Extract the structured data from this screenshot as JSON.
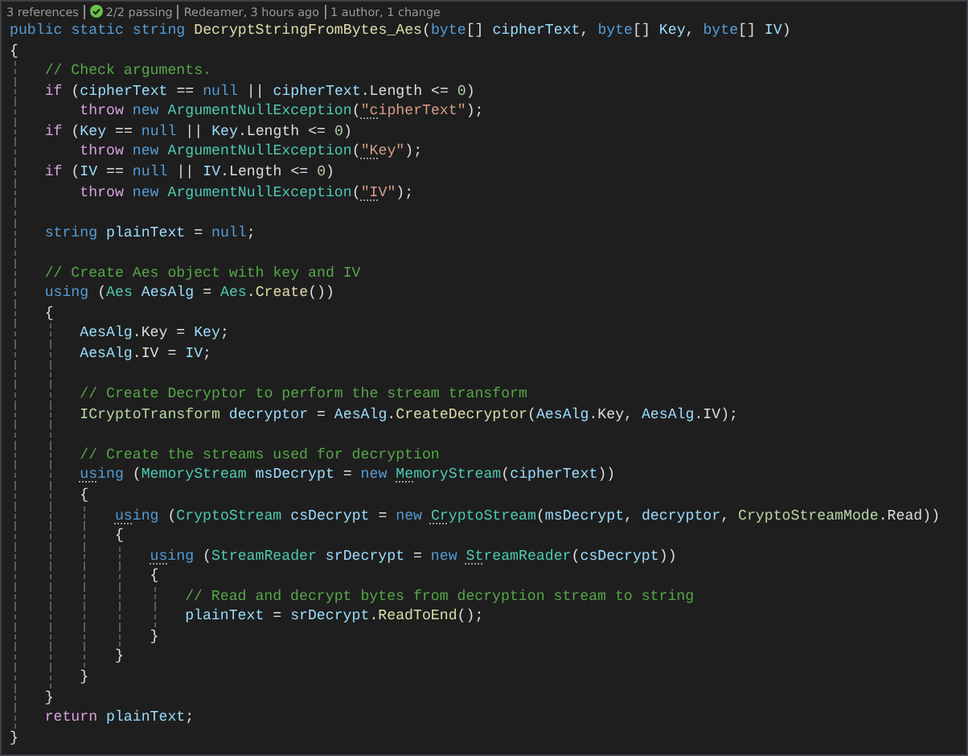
{
  "codelens": [
    {
      "kind": "text",
      "text": "3 references"
    },
    {
      "kind": "tests",
      "text": "2/2 passing",
      "passing": true
    },
    {
      "kind": "text",
      "text": "Redeamer, 3 hours ago"
    },
    {
      "kind": "text",
      "text": "1 author, 1 change"
    }
  ],
  "lines": [
    {
      "kind": "code",
      "tokens": [
        {
          "kind": "keyword",
          "text": "public static string "
        },
        {
          "kind": "method",
          "text": "DecryptStringFromBytes_Aes"
        },
        {
          "kind": "plain",
          "text": "("
        },
        {
          "kind": "keyword",
          "text": "byte"
        },
        {
          "kind": "plain",
          "text": "[] "
        },
        {
          "kind": "variable",
          "text": "cipherText"
        },
        {
          "kind": "plain",
          "text": ", "
        },
        {
          "kind": "keyword",
          "text": "byte"
        },
        {
          "kind": "plain",
          "text": "[] "
        },
        {
          "kind": "variable",
          "text": "Key"
        },
        {
          "kind": "plain",
          "text": ", "
        },
        {
          "kind": "keyword",
          "text": "byte"
        },
        {
          "kind": "plain",
          "text": "[] "
        },
        {
          "kind": "variable",
          "text": "IV"
        },
        {
          "kind": "plain",
          "text": ")"
        }
      ]
    },
    {
      "kind": "code",
      "tokens": [
        {
          "kind": "plain",
          "text": "{"
        }
      ]
    },
    {
      "kind": "code",
      "tokens": [
        {
          "kind": "comment",
          "text": "    // Check arguments."
        }
      ]
    },
    {
      "kind": "code",
      "tokens": [
        {
          "kind": "control",
          "text": "    if"
        },
        {
          "kind": "plain",
          "text": " ("
        },
        {
          "kind": "variable",
          "text": "cipherText"
        },
        {
          "kind": "plain",
          "text": " == "
        },
        {
          "kind": "keyword",
          "text": "null"
        },
        {
          "kind": "plain",
          "text": " || "
        },
        {
          "kind": "variable",
          "text": "cipherText"
        },
        {
          "kind": "plain",
          "text": ".Length <= "
        },
        {
          "kind": "number",
          "text": "0"
        },
        {
          "kind": "plain",
          "text": ")"
        }
      ]
    },
    {
      "kind": "code",
      "tokens": [
        {
          "kind": "control",
          "text": "        throw"
        },
        {
          "kind": "keyword",
          "text": " new"
        },
        {
          "kind": "type",
          "text": " ArgumentNullException"
        },
        {
          "kind": "plain",
          "text": "("
        },
        {
          "kind": "string",
          "text": "\"c",
          "hint": true
        },
        {
          "kind": "string",
          "text": "ipherText\""
        },
        {
          "kind": "plain",
          "text": ");"
        }
      ]
    },
    {
      "kind": "code",
      "tokens": [
        {
          "kind": "control",
          "text": "    if"
        },
        {
          "kind": "plain",
          "text": " ("
        },
        {
          "kind": "variable",
          "text": "Key"
        },
        {
          "kind": "plain",
          "text": " == "
        },
        {
          "kind": "keyword",
          "text": "null"
        },
        {
          "kind": "plain",
          "text": " || "
        },
        {
          "kind": "variable",
          "text": "Key"
        },
        {
          "kind": "plain",
          "text": ".Length <= "
        },
        {
          "kind": "number",
          "text": "0"
        },
        {
          "kind": "plain",
          "text": ")"
        }
      ]
    },
    {
      "kind": "code",
      "tokens": [
        {
          "kind": "control",
          "text": "        throw"
        },
        {
          "kind": "keyword",
          "text": " new"
        },
        {
          "kind": "type",
          "text": " ArgumentNullException"
        },
        {
          "kind": "plain",
          "text": "("
        },
        {
          "kind": "string",
          "text": "\"K",
          "hint": true
        },
        {
          "kind": "string",
          "text": "ey\""
        },
        {
          "kind": "plain",
          "text": ");"
        }
      ]
    },
    {
      "kind": "code",
      "tokens": [
        {
          "kind": "control",
          "text": "    if"
        },
        {
          "kind": "plain",
          "text": " ("
        },
        {
          "kind": "variable",
          "text": "IV"
        },
        {
          "kind": "plain",
          "text": " == "
        },
        {
          "kind": "keyword",
          "text": "null"
        },
        {
          "kind": "plain",
          "text": " || "
        },
        {
          "kind": "variable",
          "text": "IV"
        },
        {
          "kind": "plain",
          "text": ".Length <= "
        },
        {
          "kind": "number",
          "text": "0"
        },
        {
          "kind": "plain",
          "text": ")"
        }
      ]
    },
    {
      "kind": "code",
      "tokens": [
        {
          "kind": "control",
          "text": "        throw"
        },
        {
          "kind": "keyword",
          "text": " new"
        },
        {
          "kind": "type",
          "text": " ArgumentNullException"
        },
        {
          "kind": "plain",
          "text": "("
        },
        {
          "kind": "string",
          "text": "\"I",
          "hint": true
        },
        {
          "kind": "string",
          "text": "V\""
        },
        {
          "kind": "plain",
          "text": ");"
        }
      ]
    },
    {
      "kind": "blank"
    },
    {
      "kind": "code",
      "tokens": [
        {
          "kind": "keyword",
          "text": "    string"
        },
        {
          "kind": "variable",
          "text": " plainText"
        },
        {
          "kind": "plain",
          "text": " = "
        },
        {
          "kind": "keyword",
          "text": "null"
        },
        {
          "kind": "plain",
          "text": ";"
        }
      ]
    },
    {
      "kind": "blank"
    },
    {
      "kind": "code",
      "tokens": [
        {
          "kind": "comment",
          "text": "    // Create Aes object with key and IV"
        }
      ]
    },
    {
      "kind": "code",
      "tokens": [
        {
          "kind": "keyword",
          "text": "    using"
        },
        {
          "kind": "plain",
          "text": " ("
        },
        {
          "kind": "type",
          "text": "Aes"
        },
        {
          "kind": "variable",
          "text": " AesAlg"
        },
        {
          "kind": "plain",
          "text": " = "
        },
        {
          "kind": "type",
          "text": "Aes"
        },
        {
          "kind": "plain",
          "text": "."
        },
        {
          "kind": "method",
          "text": "Create"
        },
        {
          "kind": "plain",
          "text": "())"
        }
      ]
    },
    {
      "kind": "code",
      "tokens": [
        {
          "kind": "plain",
          "text": "    {"
        }
      ]
    },
    {
      "kind": "code",
      "tokens": [
        {
          "kind": "variable",
          "text": "        AesAlg"
        },
        {
          "kind": "plain",
          "text": ".Key = "
        },
        {
          "kind": "variable",
          "text": "Key"
        },
        {
          "kind": "plain",
          "text": ";"
        }
      ]
    },
    {
      "kind": "code",
      "tokens": [
        {
          "kind": "variable",
          "text": "        AesAlg"
        },
        {
          "kind": "plain",
          "text": ".IV = "
        },
        {
          "kind": "variable",
          "text": "IV"
        },
        {
          "kind": "plain",
          "text": ";"
        }
      ]
    },
    {
      "kind": "blank"
    },
    {
      "kind": "code",
      "tokens": [
        {
          "kind": "comment",
          "text": "        // Create Decryptor to perform the stream transform"
        }
      ]
    },
    {
      "kind": "code",
      "tokens": [
        {
          "kind": "interface",
          "text": "        ICryptoTransform"
        },
        {
          "kind": "variable",
          "text": " decryptor"
        },
        {
          "kind": "plain",
          "text": " = "
        },
        {
          "kind": "variable",
          "text": "AesAlg"
        },
        {
          "kind": "plain",
          "text": "."
        },
        {
          "kind": "method",
          "text": "CreateDecryptor"
        },
        {
          "kind": "plain",
          "text": "("
        },
        {
          "kind": "variable",
          "text": "AesAlg"
        },
        {
          "kind": "plain",
          "text": ".Key, "
        },
        {
          "kind": "variable",
          "text": "AesAlg"
        },
        {
          "kind": "plain",
          "text": ".IV);"
        }
      ]
    },
    {
      "kind": "blank"
    },
    {
      "kind": "code",
      "tokens": [
        {
          "kind": "comment",
          "text": "        // Create the streams used for decryption"
        }
      ]
    },
    {
      "kind": "code",
      "tokens": [
        {
          "kind": "keyword",
          "text": "        us",
          "hint": true
        },
        {
          "kind": "keyword",
          "text": "ing"
        },
        {
          "kind": "plain",
          "text": " ("
        },
        {
          "kind": "type",
          "text": "MemoryStream"
        },
        {
          "kind": "variable",
          "text": " msDecrypt"
        },
        {
          "kind": "plain",
          "text": " = "
        },
        {
          "kind": "keyword",
          "text": "new "
        },
        {
          "kind": "type",
          "text": "Me",
          "hint": true
        },
        {
          "kind": "type",
          "text": "moryStream"
        },
        {
          "kind": "plain",
          "text": "("
        },
        {
          "kind": "variable",
          "text": "cipherText"
        },
        {
          "kind": "plain",
          "text": "))"
        }
      ]
    },
    {
      "kind": "code",
      "tokens": [
        {
          "kind": "plain",
          "text": "        {"
        }
      ]
    },
    {
      "kind": "code",
      "tokens": [
        {
          "kind": "keyword",
          "text": "            us",
          "hint": true
        },
        {
          "kind": "keyword",
          "text": "ing"
        },
        {
          "kind": "plain",
          "text": " ("
        },
        {
          "kind": "type",
          "text": "CryptoStream"
        },
        {
          "kind": "variable",
          "text": " csDecrypt"
        },
        {
          "kind": "plain",
          "text": " = "
        },
        {
          "kind": "keyword",
          "text": "new "
        },
        {
          "kind": "type",
          "text": "Cr",
          "hint": true
        },
        {
          "kind": "type",
          "text": "yptoStream"
        },
        {
          "kind": "plain",
          "text": "("
        },
        {
          "kind": "variable",
          "text": "msDecrypt"
        },
        {
          "kind": "plain",
          "text": ", "
        },
        {
          "kind": "variable",
          "text": "decryptor"
        },
        {
          "kind": "plain",
          "text": ", "
        },
        {
          "kind": "enum",
          "text": "CryptoStreamMode"
        },
        {
          "kind": "plain",
          "text": ".Read))"
        }
      ]
    },
    {
      "kind": "code",
      "tokens": [
        {
          "kind": "plain",
          "text": "            {"
        }
      ]
    },
    {
      "kind": "code",
      "tokens": [
        {
          "kind": "keyword",
          "text": "                us",
          "hint": true
        },
        {
          "kind": "keyword",
          "text": "ing"
        },
        {
          "kind": "plain",
          "text": " ("
        },
        {
          "kind": "type",
          "text": "StreamReader"
        },
        {
          "kind": "variable",
          "text": " srDecrypt"
        },
        {
          "kind": "plain",
          "text": " = "
        },
        {
          "kind": "keyword",
          "text": "new "
        },
        {
          "kind": "type",
          "text": "St",
          "hint": true
        },
        {
          "kind": "type",
          "text": "reamReader"
        },
        {
          "kind": "plain",
          "text": "("
        },
        {
          "kind": "variable",
          "text": "csDecrypt"
        },
        {
          "kind": "plain",
          "text": "))"
        }
      ]
    },
    {
      "kind": "code",
      "tokens": [
        {
          "kind": "plain",
          "text": "                {"
        }
      ]
    },
    {
      "kind": "code",
      "tokens": [
        {
          "kind": "comment",
          "text": "                    // Read and decrypt bytes from decryption stream to string"
        }
      ]
    },
    {
      "kind": "code",
      "tokens": [
        {
          "kind": "variable",
          "text": "                    plainText"
        },
        {
          "kind": "plain",
          "text": " = "
        },
        {
          "kind": "variable",
          "text": "srDecrypt"
        },
        {
          "kind": "plain",
          "text": "."
        },
        {
          "kind": "method",
          "text": "ReadToEnd"
        },
        {
          "kind": "plain",
          "text": "();"
        }
      ]
    },
    {
      "kind": "code",
      "tokens": [
        {
          "kind": "plain",
          "text": "                }"
        }
      ]
    },
    {
      "kind": "code",
      "tokens": [
        {
          "kind": "plain",
          "text": "            }"
        }
      ]
    },
    {
      "kind": "code",
      "tokens": [
        {
          "kind": "plain",
          "text": "        }"
        }
      ]
    },
    {
      "kind": "code",
      "tokens": [
        {
          "kind": "plain",
          "text": "    }"
        }
      ]
    },
    {
      "kind": "code",
      "tokens": [
        {
          "kind": "control",
          "text": "    return"
        },
        {
          "kind": "variable",
          "text": " plainText"
        },
        {
          "kind": "plain",
          "text": ";"
        }
      ]
    },
    {
      "kind": "code",
      "tokens": [
        {
          "kind": "plain",
          "text": "}"
        }
      ]
    }
  ]
}
